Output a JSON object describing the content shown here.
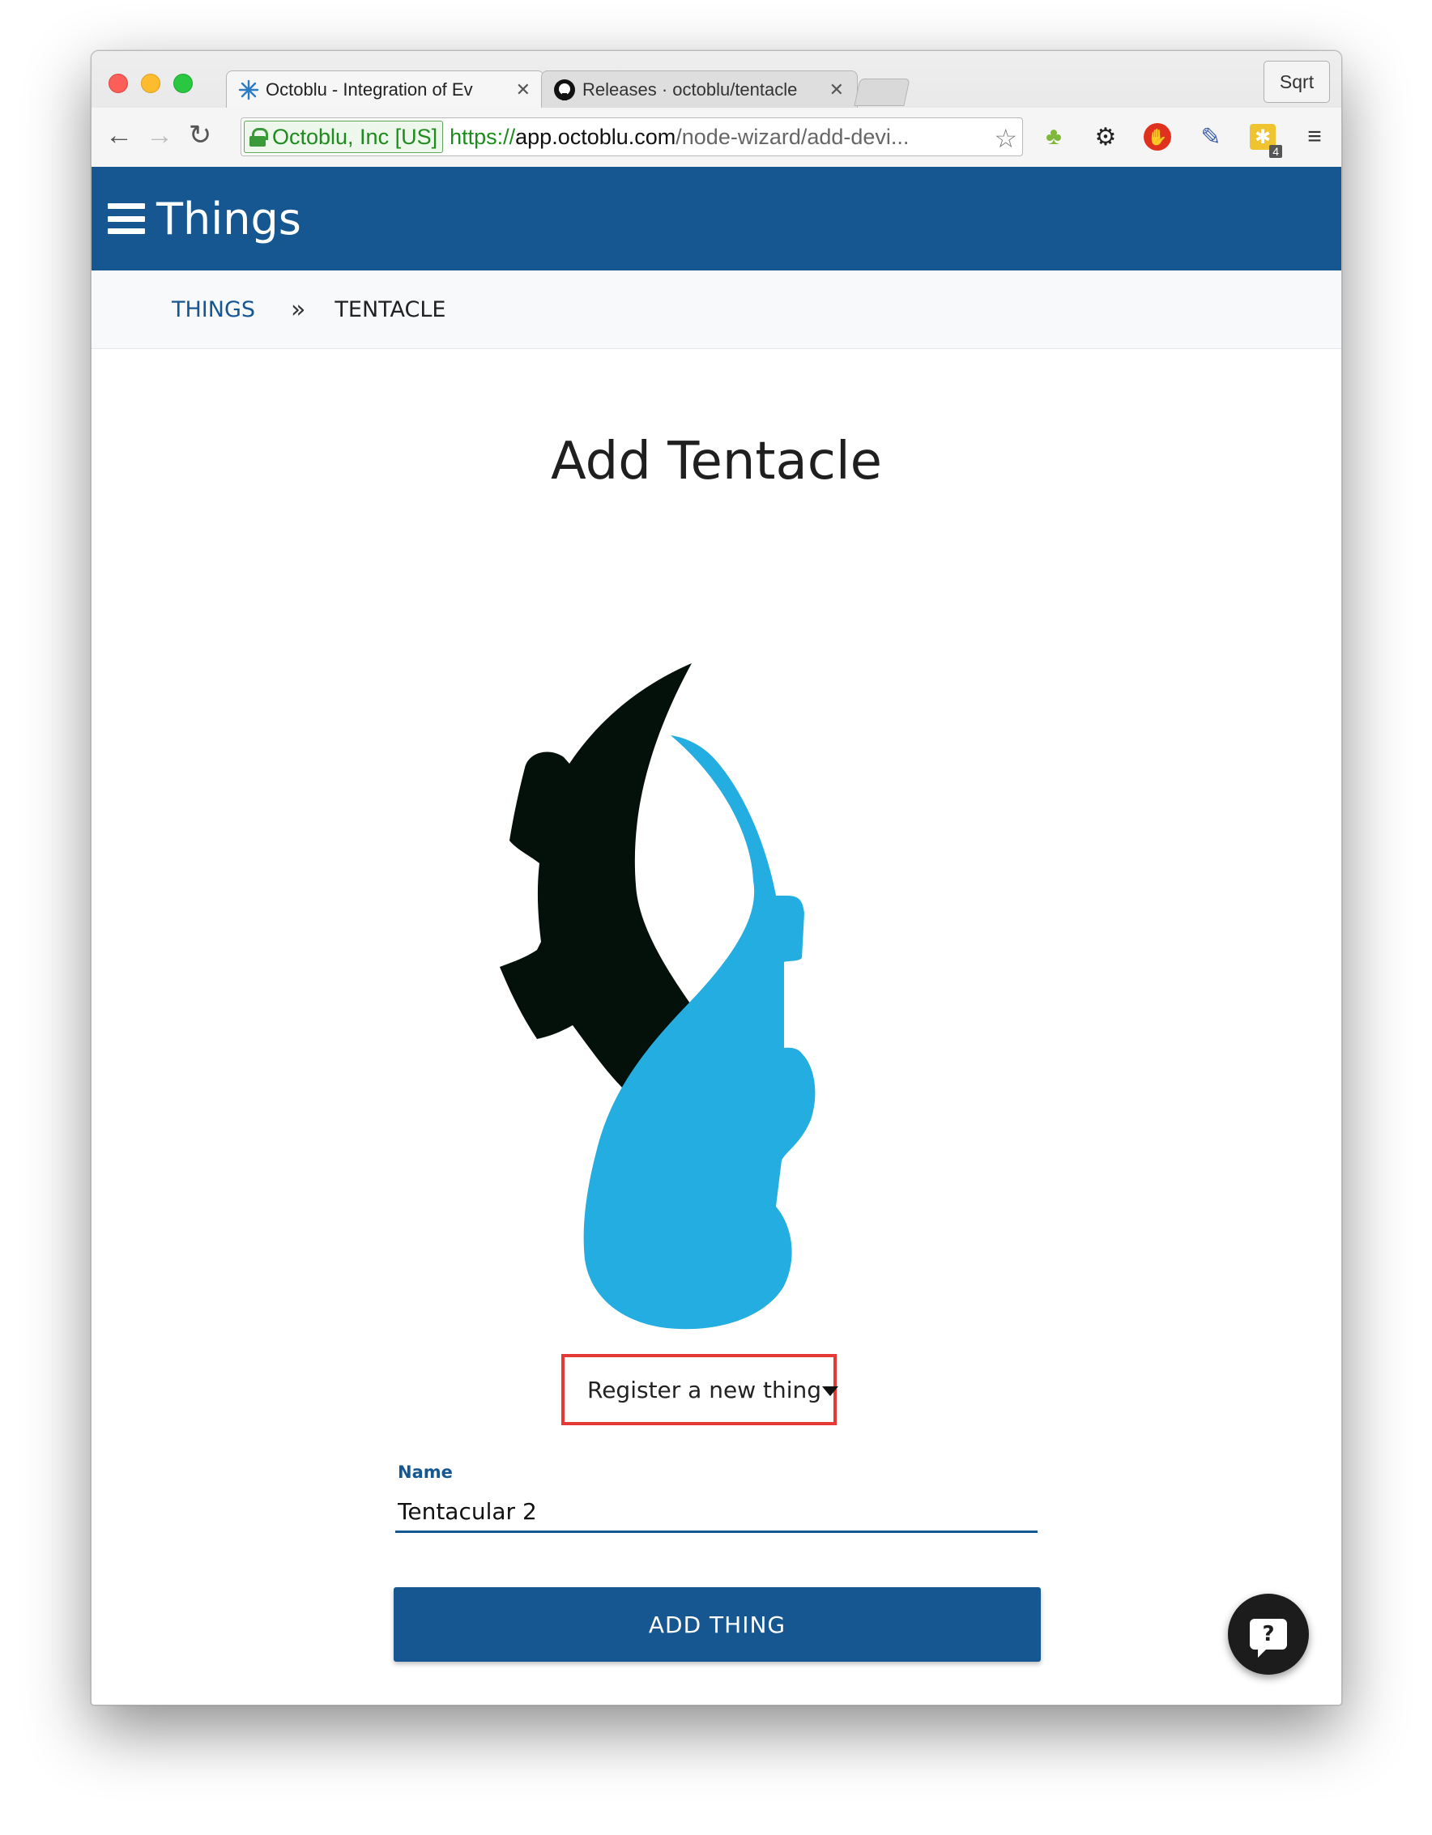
{
  "browser": {
    "tabs": [
      {
        "title": "Octoblu - Integration of Ev",
        "active": true
      },
      {
        "title": "Releases · octoblu/tentacle",
        "active": false
      }
    ],
    "profile_name": "Sqrt",
    "address": {
      "ev_label": "Octoblu, Inc [US]",
      "scheme": "https://",
      "host": "app.octoblu.com",
      "path": "/node-wizard/add-devi..."
    },
    "extensions": [
      "tree-icon",
      "gear-icon",
      "stop-hand-icon",
      "eyedropper-icon",
      "puzzle-icon",
      "menu-icon"
    ],
    "extension_badge_count": "4"
  },
  "app": {
    "header_title": "Things",
    "header_color": "#165792",
    "breadcrumb": {
      "link": "THINGS",
      "separator": "»",
      "current": "TENTACLE"
    },
    "page_title": "Add Tentacle",
    "logo": {
      "name": "tentacle-logo",
      "colors": [
        "#03110a",
        "#24ade1"
      ]
    },
    "register_select": {
      "value": "Register a new thing"
    },
    "name_field": {
      "label": "Name",
      "value": "Tentacular 2"
    },
    "submit_label": "ADD THING",
    "help_label": "?"
  }
}
